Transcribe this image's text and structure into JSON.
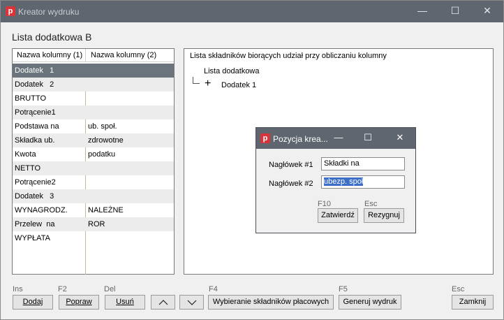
{
  "window": {
    "title": "Kreator wydruku",
    "controls": {
      "minimize": "—",
      "maximize": "☐",
      "close": "✕"
    }
  },
  "heading": "Lista dodatkowa B",
  "left_table": {
    "headers": [
      "Nazwa kolumny (1)",
      "Nazwa kolumny (2)"
    ],
    "rows": [
      {
        "c1": "Dodatek   1",
        "c2": "",
        "selected": true
      },
      {
        "c1": "Dodatek   2",
        "c2": ""
      },
      {
        "c1": "BRUTTO",
        "c2": ""
      },
      {
        "c1": "Potrącenie1",
        "c2": ""
      },
      {
        "c1": "Podstawa na",
        "c2": "ub. społ."
      },
      {
        "c1": "Składka ub.",
        "c2": "zdrowotne"
      },
      {
        "c1": "Kwota",
        "c2": "podatku"
      },
      {
        "c1": "NETTO",
        "c2": ""
      },
      {
        "c1": "Potrącenie2",
        "c2": ""
      },
      {
        "c1": "Dodatek   3",
        "c2": ""
      },
      {
        "c1": "WYNAGRODZ.",
        "c2": "NALEŻNE"
      },
      {
        "c1": "Przelew  na",
        "c2": "ROR"
      },
      {
        "c1": "WYPŁATA",
        "c2": ""
      }
    ]
  },
  "right_panel": {
    "title": "Lista składników biorących udział przy obliczaniu kolumny",
    "tree_root": "Lista dodatkowa",
    "tree_child": "Dodatek 1"
  },
  "buttons": {
    "add": {
      "key": "Ins",
      "label": "Dodaj"
    },
    "edit": {
      "key": "F2",
      "label": "Popraw"
    },
    "delete": {
      "key": "Del",
      "label": "Usuń"
    },
    "select_components": {
      "key": "F4",
      "label": "Wybieranie składników płacowych"
    },
    "generate": {
      "key": "F5",
      "label": "Generuj wydruk"
    },
    "close": {
      "key": "Esc",
      "label": "Zamknij"
    }
  },
  "dialog": {
    "title": "Pozycja krea...",
    "controls": {
      "minimize": "—",
      "maximize": "☐",
      "close": "✕"
    },
    "header1_label": "Nagłówek #1",
    "header1_value": "Składki na",
    "header2_label": "Nagłówek #2",
    "header2_value": "ubezp. społ",
    "confirm": {
      "key": "F10",
      "label": "Zatwierdź"
    },
    "cancel": {
      "key": "Esc",
      "label": "Rezygnuj"
    }
  },
  "icons": [
    "app-logo-icon",
    "arrow-up-icon",
    "arrow-down-icon"
  ],
  "colors": {
    "titlebar": "#5f6670",
    "selected_row": "#6b737d",
    "logo": "#d9343a",
    "highlight": "#3b6fc6"
  }
}
